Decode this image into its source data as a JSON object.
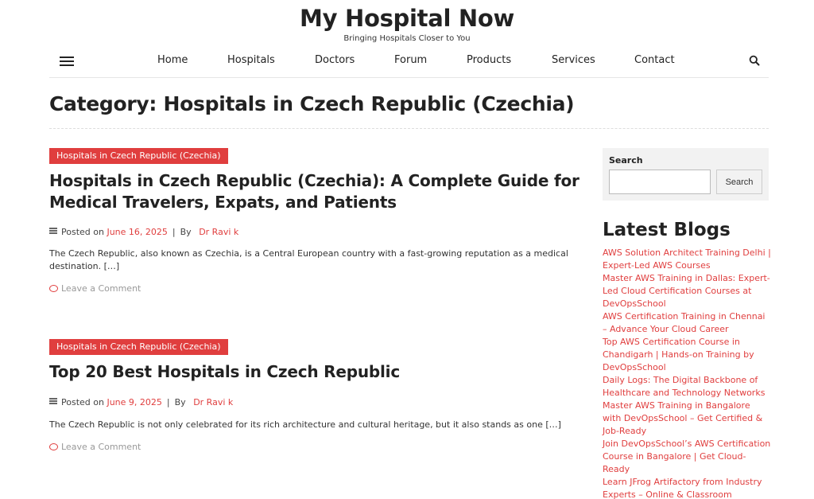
{
  "header": {
    "site_title": "My Hospital Now",
    "tagline": "Bringing Hospitals Closer to You"
  },
  "nav": {
    "items": [
      {
        "label": "Home"
      },
      {
        "label": "Hospitals"
      },
      {
        "label": "Doctors"
      },
      {
        "label": "Forum"
      },
      {
        "label": "Products"
      },
      {
        "label": "Services"
      },
      {
        "label": "Contact"
      }
    ],
    "menu_icon": "hamburger-icon",
    "search_icon": "search-icon"
  },
  "category": {
    "title": "Category: Hospitals in Czech Republic (Czechia)"
  },
  "posts": [
    {
      "category": "Hospitals in Czech Republic (Czechia)",
      "title": "Hospitals in Czech Republic (Czechia): A Complete Guide for Medical Travelers, Expats, and Patients",
      "posted_on_label": "Posted on",
      "date": "June 16, 2025",
      "separator": "|",
      "by_label": "By",
      "author": "Dr Ravi k",
      "excerpt": "The Czech Republic, also known as Czechia, is a Central European country with a fast-growing reputation as a medical destination. […]",
      "comment_label": "Leave a Comment"
    },
    {
      "category": "Hospitals in Czech Republic (Czechia)",
      "title": "Top 20 Best Hospitals in Czech Republic",
      "posted_on_label": "Posted on",
      "date": "June 9, 2025",
      "separator": "|",
      "by_label": "By",
      "author": "Dr Ravi k",
      "excerpt": "The Czech Republic is not only celebrated for its rich architecture and cultural heritage, but it also stands as one […]",
      "comment_label": "Leave a Comment"
    }
  ],
  "sidebar": {
    "search": {
      "label": "Search",
      "input_value": "",
      "button_label": "Search"
    },
    "latest_blogs": {
      "title": "Latest Blogs",
      "items": [
        "AWS Solution Architect Training Delhi | Expert-Led AWS Courses",
        "Master AWS Training in Dallas: Expert-Led Cloud Certification Courses at DevOpsSchool",
        "AWS Certification Training in Chennai – Advance Your Cloud Career",
        "Top AWS Certification Course in Chandigarh | Hands-on Training by DevOpsSchool",
        "Daily Logs: The Digital Backbone of Healthcare and Technology Networks",
        "Master AWS Training in Bangalore with DevOpsSchool – Get Certified & Job-Ready",
        "Join DevOpsSchool’s AWS Certification Course in Bangalore | Get Cloud-Ready",
        "Learn JFrog Artifactory from Industry Experts – Online & Classroom"
      ]
    }
  },
  "colors": {
    "accent": "#e03e3e",
    "text": "#222222",
    "sidebar_bg": "#f2f2f2"
  }
}
